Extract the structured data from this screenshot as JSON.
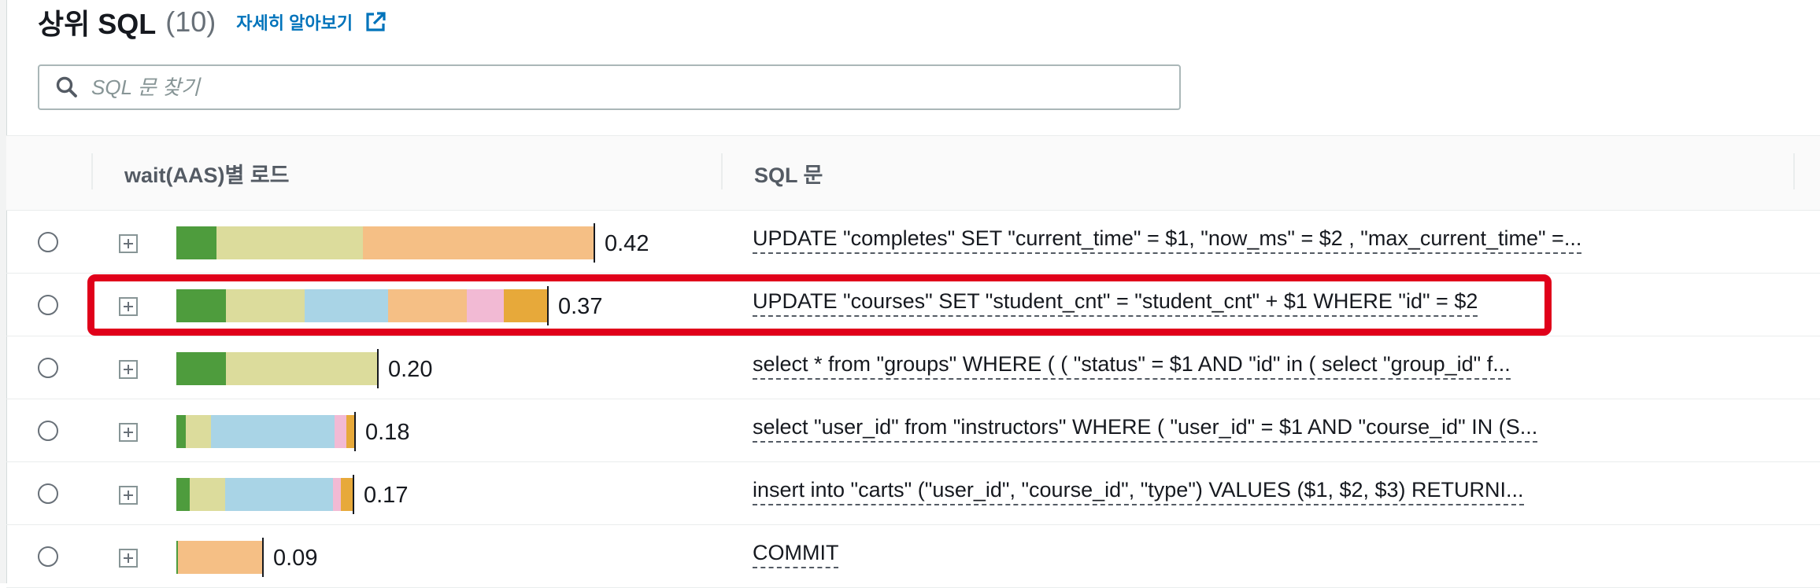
{
  "header": {
    "title": "상위 SQL",
    "count": "(10)",
    "info_link": "자세히 알아보기"
  },
  "search": {
    "placeholder": "SQL 문 찾기"
  },
  "table": {
    "columns": [
      "wait(AAS)별 로드",
      "SQL 문"
    ],
    "rows": [
      {
        "value": "0.42",
        "sql": "UPDATE \"completes\" SET \"current_time\" = $1, \"now_ms\" = $2 , \"max_current_time\" =...",
        "segments": [
          [
            "green",
            0.041
          ],
          [
            "khaki",
            0.149
          ],
          [
            "peach",
            0.235
          ]
        ]
      },
      {
        "value": "0.37",
        "sql": "UPDATE \"courses\" SET \"student_cnt\" = \"student_cnt\" + $1 WHERE \"id\" = $2",
        "segments": [
          [
            "green",
            0.051
          ],
          [
            "khaki",
            0.08
          ],
          [
            "blue",
            0.085
          ],
          [
            "peach",
            0.08
          ],
          [
            "pink",
            0.038
          ],
          [
            "orange",
            0.044
          ]
        ]
      },
      {
        "value": "0.20",
        "sql": "select * from \"groups\" WHERE ( ( \"status\" = $1 AND \"id\" in ( select \"group_id\" f...",
        "segments": [
          [
            "green",
            0.051
          ],
          [
            "khaki",
            0.154
          ]
        ]
      },
      {
        "value": "0.18",
        "sql": "select \"user_id\" from \"instructors\" WHERE ( \"user_id\" = $1 AND \"course_id\" IN (S...",
        "segments": [
          [
            "green",
            0.01
          ],
          [
            "khaki",
            0.026
          ],
          [
            "blue",
            0.126
          ],
          [
            "pink",
            0.012
          ],
          [
            "orange",
            0.008
          ]
        ]
      },
      {
        "value": "0.17",
        "sql": "insert into \"carts\" (\"user_id\", \"course_id\", \"type\") VALUES ($1, $2, $3) RETURNI...",
        "segments": [
          [
            "green",
            0.014
          ],
          [
            "khaki",
            0.036
          ],
          [
            "blue",
            0.11
          ],
          [
            "pink",
            0.008
          ],
          [
            "orange",
            0.012
          ]
        ]
      },
      {
        "value": "0.09",
        "sql": "COMMIT",
        "segments": [
          [
            "green",
            0.002
          ],
          [
            "peach",
            0.086
          ]
        ]
      }
    ],
    "highlighted_row": 1
  },
  "colors": {
    "green": "#4e9c3d",
    "khaki": "#dcdc9c",
    "blue": "#a9d4e6",
    "peach": "#f5bf85",
    "pink": "#f2bad4",
    "orange": "#e7a93a",
    "highlight": "#e0001a",
    "link": "#0073bb"
  }
}
